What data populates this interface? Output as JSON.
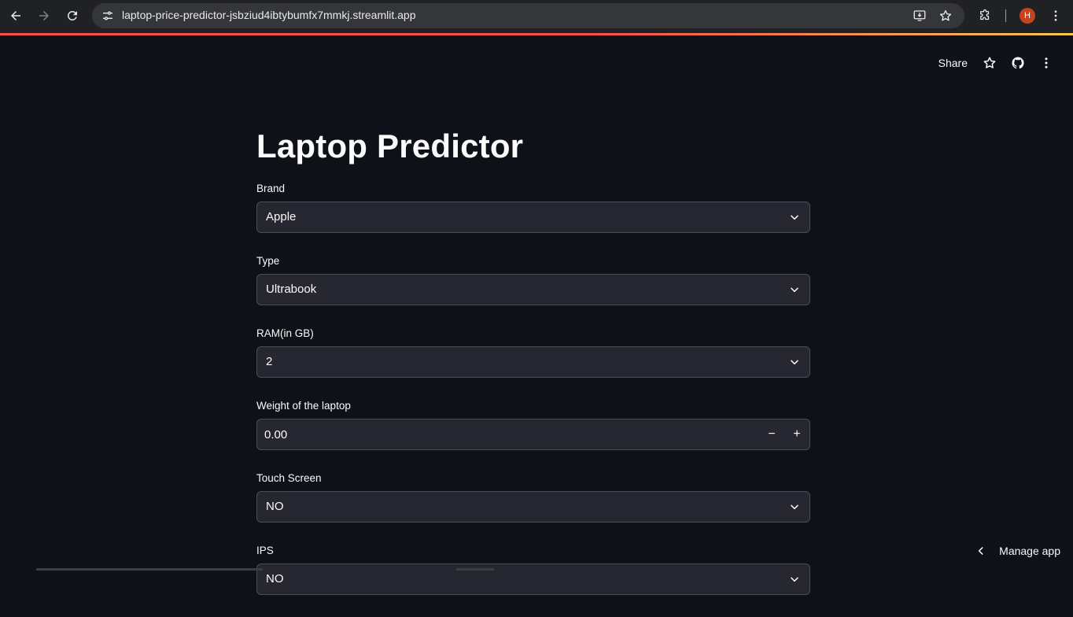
{
  "browser": {
    "url": "laptop-price-predictor-jsbziud4ibtybumfx7mmkj.streamlit.app",
    "profile_initial": "H",
    "accent_color": "#ff4b4b"
  },
  "toolbar": {
    "share_label": "Share",
    "icons": [
      "star-icon",
      "github-icon",
      "more-vertical-icon"
    ]
  },
  "page": {
    "title": "Laptop Predictor"
  },
  "fields": {
    "brand": {
      "label": "Brand",
      "value": "Apple"
    },
    "type": {
      "label": "Type",
      "value": "Ultrabook"
    },
    "ram": {
      "label": "RAM(in GB)",
      "value": "2"
    },
    "weight": {
      "label": "Weight of the laptop",
      "value": "0.00",
      "decrement": "−",
      "increment": "+"
    },
    "touch": {
      "label": "Touch Screen",
      "value": "NO"
    },
    "ips": {
      "label": "IPS",
      "value": "NO"
    }
  },
  "footer": {
    "manage_app_label": "Manage app"
  },
  "colors": {
    "background": "#0e1117",
    "input_bg": "#262730",
    "text": "#fafafa"
  }
}
